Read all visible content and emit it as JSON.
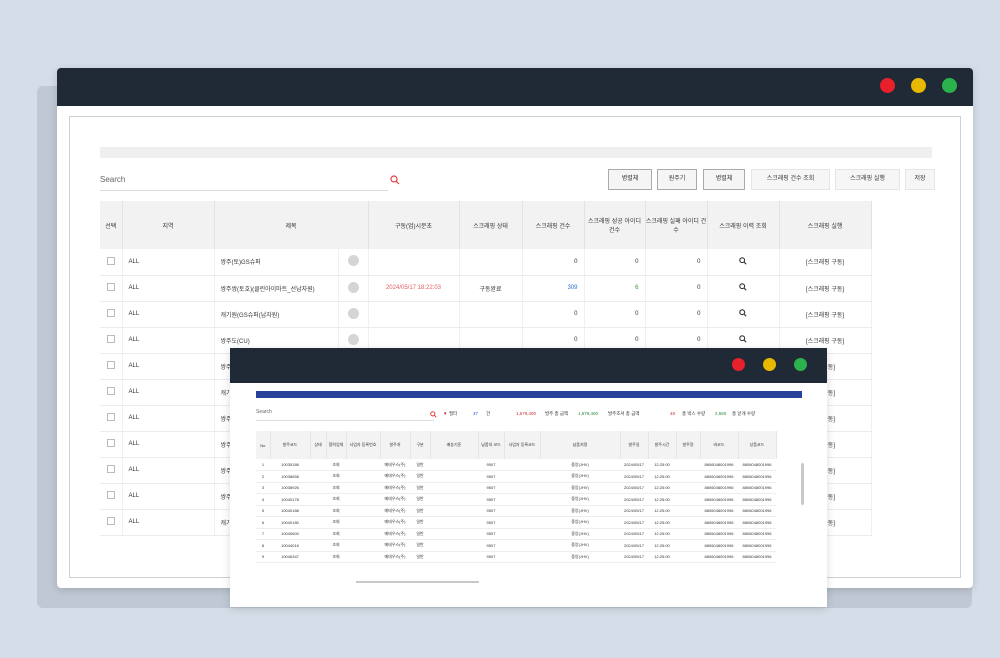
{
  "colors": {
    "titlebar": "#1f2a36",
    "red": "#e8202b",
    "yellow": "#e9b800",
    "green": "#2bb24c",
    "accent_blue": "#27409a"
  },
  "main": {
    "search_placeholder": "Search",
    "buttons": [
      "병렬체",
      "원주기",
      "병렬체",
      "스크래핑 건수 조회",
      "스크래핑 실행",
      "저장"
    ],
    "columns": [
      "선택",
      "지역",
      "제목",
      "",
      "구동(업)시분초",
      "스크래핑 상태",
      "스크래핑 건수",
      "스크래핑 성공 아이디 건수",
      "스크래핑 실패 아이디 건수",
      "스크래핑 이력 조회",
      "스크래핑 실행"
    ],
    "rows": [
      {
        "region": "ALL",
        "title": "쌍주(토)GS슈퍼",
        "time": "",
        "status": "",
        "count": "0",
        "success": "0",
        "fail": "0",
        "run": "[스크래핑 구동]"
      },
      {
        "region": "ALL",
        "title": "쌍주쌍(토호)(클린아이마트_선납자원)",
        "time": "2024/05/17 18:22:03",
        "status": "구동완료",
        "count": "309",
        "success": "6",
        "fail": "0",
        "run": "[스크래핑 구동]"
      },
      {
        "region": "ALL",
        "title": "캐기원(GS슈퍼(납자원)",
        "time": "",
        "status": "",
        "count": "0",
        "success": "0",
        "fail": "0",
        "run": "[스크래핑 구동]"
      },
      {
        "region": "ALL",
        "title": "쌍주도(CU)",
        "time": "",
        "status": "",
        "count": "0",
        "success": "0",
        "fail": "0",
        "run": "[스크래핑 구동]"
      },
      {
        "region": "ALL",
        "title": "쌍주",
        "time": "",
        "status": "",
        "count": "",
        "success": "",
        "fail": "",
        "run": "링 구동]"
      },
      {
        "region": "ALL",
        "title": "캐기",
        "time": "",
        "status": "",
        "count": "",
        "success": "",
        "fail": "",
        "run": "링 구동]"
      },
      {
        "region": "ALL",
        "title": "쌍주",
        "time": "",
        "status": "",
        "count": "",
        "success": "",
        "fail": "",
        "run": "링 구동]"
      },
      {
        "region": "ALL",
        "title": "쌍주",
        "time": "",
        "status": "",
        "count": "",
        "success": "",
        "fail": "",
        "run": "링 구동]"
      },
      {
        "region": "ALL",
        "title": "쌍주",
        "time": "",
        "status": "",
        "count": "",
        "success": "",
        "fail": "",
        "run": "링 구동]"
      },
      {
        "region": "ALL",
        "title": "쌍주",
        "time": "",
        "status": "",
        "count": "",
        "success": "",
        "fail": "",
        "run": "링 구동]"
      },
      {
        "region": "ALL",
        "title": "캐기",
        "time": "",
        "status": "",
        "count": "",
        "success": "",
        "fail": "",
        "run": "링 구동]"
      }
    ]
  },
  "detail": {
    "search_placeholder": "Search",
    "filter_label": "필터",
    "count": "37",
    "count_unit": "건",
    "sum1": "1,679,400",
    "sum1_label": "발주 총 금액",
    "sum2": "1,679,400",
    "sum2_label": "발주조서 총 금액",
    "boxes": "48",
    "boxes_label": "총 박스 수량",
    "items": "2,560",
    "items_label": "총 낱개 수량",
    "columns": [
      "No",
      "발주코드",
      "상태",
      "협력업체",
      "사업자 등록번호",
      "발주처",
      "구분",
      "배송기준",
      "납품처 코드",
      "사업자 등록코드",
      "납품처명",
      "발주일",
      "발주시간",
      "발주량",
      "바코드",
      "상품코드"
    ],
    "rows": [
      {
        "no": "1",
        "code": "10035186"
      },
      {
        "no": "2",
        "code": "10038658"
      },
      {
        "no": "3",
        "code": "10038926"
      },
      {
        "no": "4",
        "code": "10040178"
      },
      {
        "no": "5",
        "code": "10040188"
      },
      {
        "no": "6",
        "code": "10040180"
      },
      {
        "no": "7",
        "code": "10040600"
      },
      {
        "no": "8",
        "code": "10044016"
      },
      {
        "no": "9",
        "code": "10046347"
      }
    ],
    "row_values": {
      "state": "조회",
      "vendor": "메테우스(주)",
      "kind": "일반",
      "store": "9507",
      "store_name": "중앙(JHV)",
      "date": "2024/05/17",
      "time": "12:25:00",
      "barcode": "8806048001996"
    }
  }
}
